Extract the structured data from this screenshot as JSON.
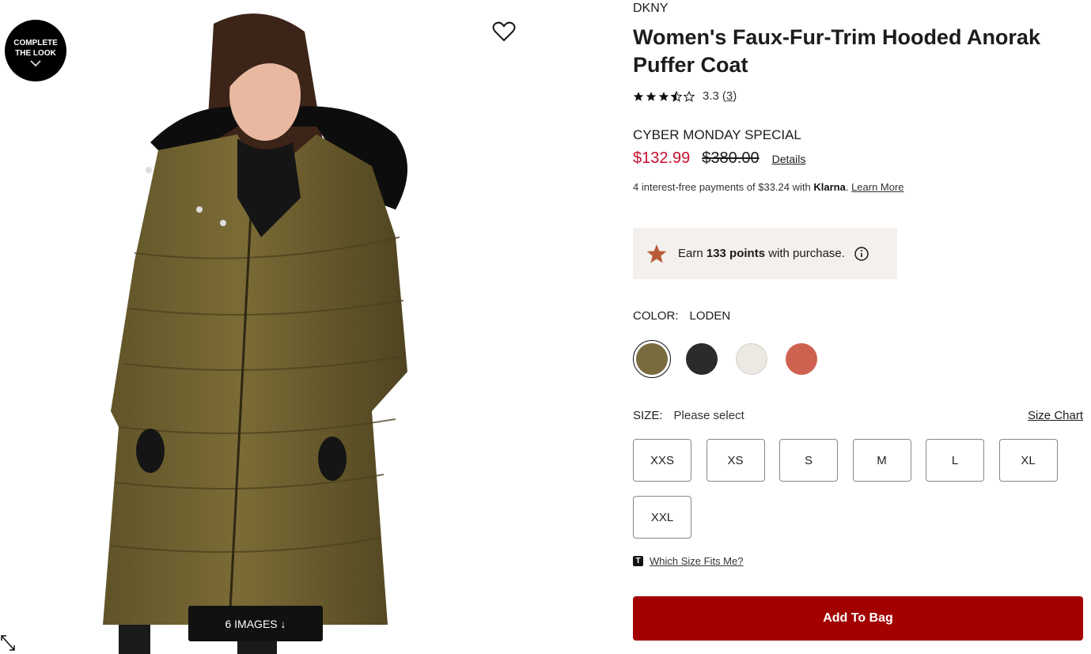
{
  "gallery": {
    "complete_look_label": "COMPLETE THE LOOK",
    "images_button_label": "6 IMAGES ↓",
    "icons": [
      "heart-icon",
      "expand-icon",
      "chevron-down-icon"
    ]
  },
  "product": {
    "brand": "DKNY",
    "title": "Women's Faux-Fur-Trim Hooded Anorak Puffer Coat",
    "rating": 3.3,
    "rating_display": "3.3",
    "review_count_prefix": "(",
    "review_count": "3",
    "review_count_suffix": ")",
    "stars": [
      "full",
      "full",
      "full",
      "half",
      "empty"
    ]
  },
  "pricing": {
    "promo_label": "CYBER MONDAY SPECIAL",
    "sale_price": "$132.99",
    "original_price": "$380.00",
    "details_link": "Details",
    "klarna_text": "4 interest-free payments of $33.24 with ",
    "klarna_brand": "Klarna",
    "klarna_dot": ". ",
    "klarna_link": "Learn More",
    "sale_color": "#c8102e"
  },
  "points": {
    "prefix": "Earn ",
    "amount": "133 points",
    "suffix": " with purchase.",
    "star_color": "#b85c38"
  },
  "color": {
    "label": "COLOR:",
    "selected": "LODEN",
    "swatches": [
      {
        "name": "loden",
        "hex": "#7a6b3e",
        "selected": true
      },
      {
        "name": "black",
        "hex": "#2b2b2b",
        "selected": false
      },
      {
        "name": "cream",
        "hex": "#ece8e2",
        "selected": false
      },
      {
        "name": "coral",
        "hex": "#cf6150",
        "selected": false
      }
    ]
  },
  "size": {
    "label": "SIZE:",
    "value": "Please select",
    "chart_link": "Size Chart",
    "options": [
      "XXS",
      "XS",
      "S",
      "M",
      "L",
      "XL",
      "XXL"
    ],
    "fit_icon": "T",
    "fit_link": "Which Size Fits Me?"
  },
  "actions": {
    "add_to_bag": "Add To Bag",
    "add_to_bag_color": "#a30000"
  }
}
